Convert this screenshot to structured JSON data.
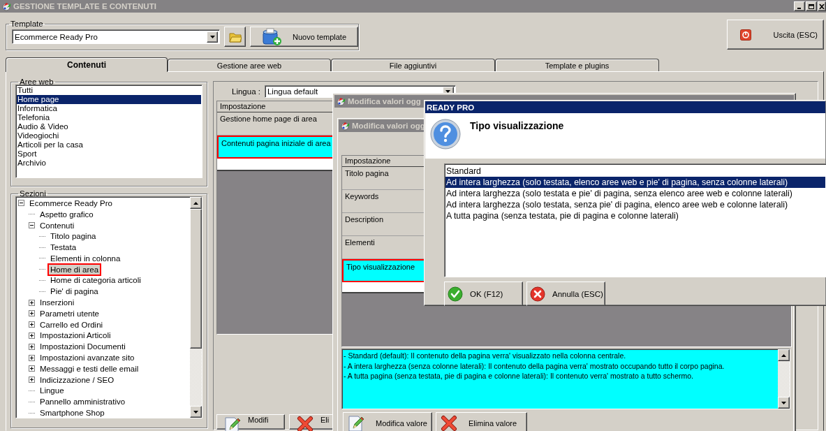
{
  "window": {
    "title": "GESTIONE TEMPLATE E CONTENUTI"
  },
  "template": {
    "label": "Template",
    "value": "Ecommerce Ready Pro",
    "new_button": "Nuovo template"
  },
  "exit_button": "Uscita (ESC)",
  "tabs": [
    {
      "label": "Contenuti",
      "selected": true
    },
    {
      "label": "Gestione aree web",
      "selected": false
    },
    {
      "label": "File aggiuntivi",
      "selected": false
    },
    {
      "label": "Template e plugins",
      "selected": false
    }
  ],
  "web_areas": {
    "title": "Aree web",
    "items": [
      {
        "label": "Tutti",
        "selected": false
      },
      {
        "label": "Home page",
        "selected": true
      },
      {
        "label": "Informatica",
        "selected": false
      },
      {
        "label": "Telefonia",
        "selected": false
      },
      {
        "label": "Audio & Video",
        "selected": false
      },
      {
        "label": "Videogiochi",
        "selected": false
      },
      {
        "label": "Articoli per la casa",
        "selected": false
      },
      {
        "label": "Sport",
        "selected": false
      },
      {
        "label": "Archivio",
        "selected": false
      }
    ]
  },
  "sections": {
    "title": "Sezioni",
    "tree": [
      {
        "label": "Ecommerce Ready Pro",
        "expanded": true,
        "selected": false,
        "marked": false,
        "children": [
          {
            "label": "Aspetto grafico",
            "selected": false,
            "marked": false
          },
          {
            "label": "Contenuti",
            "expanded": true,
            "selected": false,
            "marked": false,
            "children": [
              {
                "label": "Titolo pagina",
                "selected": false,
                "marked": false
              },
              {
                "label": "Testata",
                "selected": false,
                "marked": false
              },
              {
                "label": "Elementi in colonna",
                "selected": false,
                "marked": false
              },
              {
                "label": "Home di area",
                "selected": true,
                "marked": true
              },
              {
                "label": "Home di categoria articoli",
                "selected": false,
                "marked": false
              },
              {
                "label": "Pie' di pagina",
                "selected": false,
                "marked": false
              }
            ]
          },
          {
            "label": "Inserzioni",
            "expanded": false,
            "selected": false,
            "marked": false
          },
          {
            "label": "Parametri utente",
            "expanded": false,
            "selected": false,
            "marked": false
          },
          {
            "label": "Carrello ed Ordini",
            "expanded": false,
            "selected": false,
            "marked": false
          },
          {
            "label": "Impostazioni Articoli",
            "expanded": false,
            "selected": false,
            "marked": false
          },
          {
            "label": "Impostazioni Documenti",
            "expanded": false,
            "selected": false,
            "marked": false
          },
          {
            "label": "Impostazioni avanzate sito",
            "expanded": false,
            "selected": false,
            "marked": false
          },
          {
            "label": "Messaggi e testi delle email",
            "expanded": false,
            "selected": false,
            "marked": false
          },
          {
            "label": "Indicizzazione / SEO",
            "expanded": false,
            "selected": false,
            "marked": false
          },
          {
            "label": "Lingue",
            "selected": false,
            "marked": false
          },
          {
            "label": "Pannello amministrativo",
            "selected": false,
            "marked": false
          },
          {
            "label": "Smartphone Shop",
            "selected": false,
            "marked": false
          }
        ]
      }
    ]
  },
  "language": {
    "label": "Lingua :",
    "value": "Lingua default"
  },
  "settings_table": {
    "header": "Impostazione",
    "rows": [
      {
        "label": "Gestione home page di area",
        "selected": false,
        "marked": false
      },
      {
        "label": "Contenuti pagina iniziale di area",
        "selected": true,
        "marked": true
      }
    ]
  },
  "bottom_buttons": [
    {
      "label": "Modifi",
      "kind": "edit"
    },
    {
      "label": "Eli",
      "kind": "delete"
    }
  ],
  "edit_dialog": {
    "title": "Modifica valori ogg",
    "inner_title": "Modifica valori ogg",
    "table": {
      "header": "Impostazione",
      "rows": [
        {
          "label": "Titolo pagina",
          "selected": false,
          "marked": false
        },
        {
          "label": "Keywords",
          "selected": false,
          "marked": false
        },
        {
          "label": "Description",
          "selected": false,
          "marked": false
        },
        {
          "label": "Elementi",
          "selected": false,
          "marked": false
        },
        {
          "label": "Tipo visualizzazione",
          "selected": true,
          "marked": true
        }
      ]
    },
    "description": [
      "- Standard (default): Il contenuto della pagina verra' visualizzato nella colonna centrale.",
      "- A intera larghezza (senza colonne laterali): Il contenuto della pagina verra' mostrato occupando tutto il corpo pagina.",
      "- A tutta pagina (senza testata, pie di pagina e colonne laterali): Il contenuto verra' mostrato a tutto schermo."
    ],
    "buttons": [
      {
        "label": "Modifica valore",
        "kind": "edit"
      },
      {
        "label": "Elimina valore",
        "kind": "delete"
      }
    ]
  },
  "prompt_dialog": {
    "title": "READY PRO",
    "heading": "Tipo visualizzazione",
    "options": [
      {
        "label": "Standard",
        "selected": false
      },
      {
        "label": "Ad intera larghezza (solo testata, elenco aree web e pie' di pagina, senza colonne laterali)",
        "selected": true
      },
      {
        "label": "Ad intera larghezza (solo testata e pie' di pagina, senza elenco aree web e colonne laterali)",
        "selected": false
      },
      {
        "label": "Ad intera larghezza (solo testata, senza pie' di pagina, elenco aree web e colonne laterali)",
        "selected": false
      },
      {
        "label": "A tutta pagina (senza testata, pie di pagina e colonne laterali)",
        "selected": false
      }
    ],
    "buttons": [
      {
        "label": "OK (F12)",
        "kind": "ok"
      },
      {
        "label": "Annulla (ESC)",
        "kind": "cancel"
      }
    ]
  }
}
